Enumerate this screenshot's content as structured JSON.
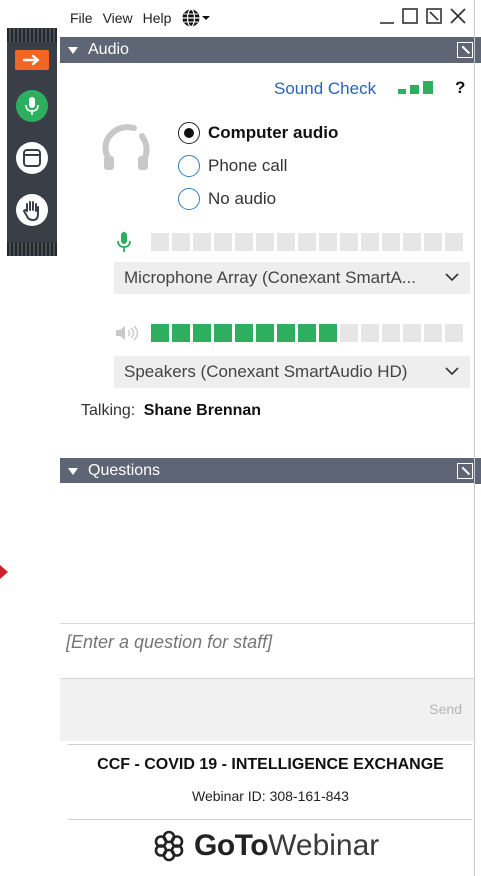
{
  "menu": {
    "file": "File",
    "view": "View",
    "help": "Help"
  },
  "audio_section": {
    "title": "Audio",
    "sound_check": "Sound Check",
    "help": "?",
    "options": [
      {
        "label": "Computer audio",
        "selected": true
      },
      {
        "label": "Phone call",
        "selected": false
      },
      {
        "label": "No audio",
        "selected": false
      }
    ],
    "microphone": {
      "device": "Microphone Array (Conexant SmartA...",
      "level_segments_on": 0,
      "level_segments_total": 15
    },
    "speakers": {
      "device": "Speakers (Conexant SmartAudio HD)",
      "level_segments_on": 9,
      "level_segments_total": 15
    },
    "talking_label": "Talking:",
    "talking_name": "Shane Brennan"
  },
  "questions_section": {
    "title": "Questions",
    "input_placeholder": "[Enter a question for staff]",
    "send_label": "Send"
  },
  "footer": {
    "webinar_title": "CCF - COVID 19 - INTELLIGENCE EXCHANGE",
    "webinar_id": "Webinar ID: 308-161-843",
    "brand_go": "Go",
    "brand_to": "To",
    "brand_webinar": "Webinar"
  },
  "colors": {
    "accent_orange": "#f26522",
    "mic_green": "#2eaf5f",
    "header_gray": "#5e6574",
    "link_blue": "#2a62b8"
  }
}
